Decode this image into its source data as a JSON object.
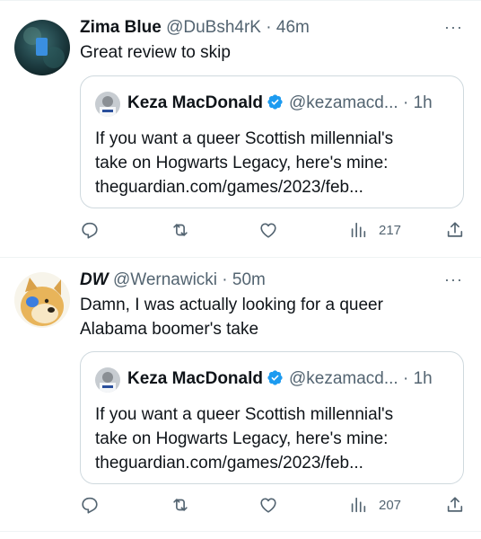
{
  "tweets": [
    {
      "name": "Zima Blue",
      "handle": "@DuBsh4rK",
      "sep": "·",
      "time": "46m",
      "text_lines": [
        "Great review to skip"
      ],
      "more": "···",
      "quote": {
        "name": "Keza MacDonald",
        "handle": "@kezamacd...",
        "sep": "·",
        "time": "1h",
        "text_lines": [
          "If you want a queer Scottish millennial's",
          "take on Hogwarts Legacy, here's mine:",
          "theguardian.com/games/2023/feb..."
        ]
      },
      "views": "217"
    },
    {
      "name": "DW",
      "handle": "@Wernawicki",
      "sep": "·",
      "time": "50m",
      "text_lines": [
        "Damn, I was actually looking for a queer",
        "Alabama boomer's take"
      ],
      "more": "···",
      "quote": {
        "name": "Keza MacDonald",
        "handle": "@kezamacd...",
        "sep": "·",
        "time": "1h",
        "text_lines": [
          "If you want a queer Scottish millennial's",
          "take on Hogwarts Legacy, here's mine:",
          "theguardian.com/games/2023/feb..."
        ]
      },
      "views": "207"
    }
  ],
  "colors": {
    "verified": "#1d9bf0",
    "secondary_text": "#536471",
    "border": "#cfd9de"
  },
  "icons": {
    "reply": "speech-bubble",
    "retweet": "two-arrows-loop",
    "like": "heart-outline",
    "views": "bar-chart",
    "share": "upload-arrow"
  }
}
